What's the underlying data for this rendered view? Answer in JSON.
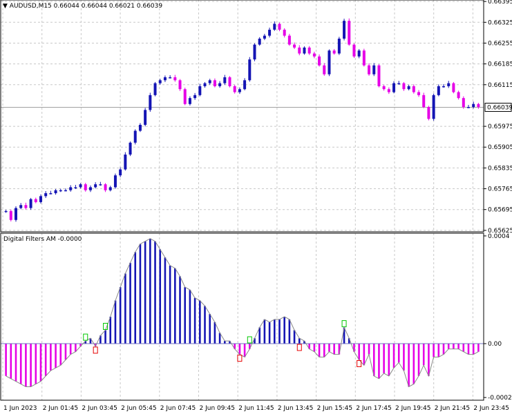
{
  "main_header": {
    "collapse_arrow": "▼",
    "symbol": "AUDUSD,M15",
    "ohlc": "0.66044 0.66044 0.66021 0.66039"
  },
  "indicator_header": {
    "text": "Digital Filters AM -0.0000"
  },
  "price_marker": "0.66039",
  "colors": {
    "bull": "#1414b4",
    "bear": "#e600e6",
    "grid": "#c8c8c8",
    "line": "#888888",
    "signal_up": "#00c800",
    "signal_down": "#e60000"
  },
  "chart_data": [
    {
      "type": "candlestick",
      "title": "AUDUSD,M15",
      "y_ticks": [
        0.66395,
        0.66325,
        0.66255,
        0.66185,
        0.66115,
        0.66039,
        0.65975,
        0.65905,
        0.65835,
        0.65765,
        0.65695,
        0.65625
      ],
      "y_tick_labels": [
        "0.66395",
        "0.66325",
        "0.66255",
        "0.66185",
        "0.66115",
        "0.66039",
        "0.65975",
        "0.65905",
        "0.65835",
        "0.65765",
        "0.65695",
        "0.65625"
      ],
      "last_price": 0.66039,
      "ylim": [
        0.6562,
        0.664
      ],
      "closes": [
        0.6569,
        0.6566,
        0.657,
        0.6571,
        0.657,
        0.6573,
        0.6572,
        0.6574,
        0.6575,
        0.6575,
        0.6576,
        0.6576,
        0.6576,
        0.6577,
        0.6577,
        0.6578,
        0.6576,
        0.6577,
        0.6578,
        0.6578,
        0.6576,
        0.6577,
        0.6581,
        0.6583,
        0.6588,
        0.6592,
        0.6596,
        0.6598,
        0.6603,
        0.6608,
        0.6612,
        0.6613,
        0.6614,
        0.6614,
        0.6613,
        0.661,
        0.6605,
        0.6607,
        0.6608,
        0.6611,
        0.6612,
        0.6613,
        0.6611,
        0.6612,
        0.6614,
        0.6611,
        0.6609,
        0.661,
        0.6613,
        0.662,
        0.6625,
        0.6627,
        0.6628,
        0.663,
        0.6632,
        0.663,
        0.6628,
        0.6625,
        0.6624,
        0.6622,
        0.6624,
        0.6622,
        0.6621,
        0.6618,
        0.6615,
        0.6623,
        0.6622,
        0.6627,
        0.6633,
        0.6625,
        0.6621,
        0.6623,
        0.6618,
        0.6615,
        0.6618,
        0.6611,
        0.661,
        0.6609,
        0.6612,
        0.6612,
        0.661,
        0.6611,
        0.6609,
        0.6608,
        0.6604,
        0.66,
        0.6608,
        0.6611,
        0.6611,
        0.6612,
        0.6609,
        0.6607,
        0.6604,
        0.6604,
        0.6605,
        0.6604
      ]
    },
    {
      "type": "histogram",
      "title": "Digital Filters AM -0.0000",
      "y_ticks": [
        0.0004,
        0.0,
        -0.0002
      ],
      "y_tick_labels": [
        "0.0004",
        "0.00",
        "-0.0002"
      ],
      "ylim": [
        -0.00021,
        0.00041
      ],
      "values": [
        -0.00012,
        -0.00013,
        -0.00014,
        -0.00015,
        -0.00016,
        -0.00016,
        -0.00015,
        -0.00014,
        -0.00012,
        -0.0001,
        -9e-05,
        -8e-05,
        -6e-05,
        -4e-05,
        -3e-05,
        -1e-05,
        1e-05,
        2e-05,
        -1e-05,
        3e-05,
        5e-05,
        0.0001,
        0.00016,
        0.00021,
        0.00026,
        0.0003,
        0.00034,
        0.00037,
        0.00038,
        0.00039,
        0.00038,
        0.00035,
        0.00032,
        0.00029,
        0.00028,
        0.00025,
        0.00021,
        0.0002,
        0.00017,
        0.00016,
        0.00014,
        0.00011,
        8e-05,
        4e-05,
        1e-05,
        1e-05,
        -2e-05,
        -4e-05,
        -5e-05,
        -2e-05,
        2e-05,
        6e-05,
        9e-05,
        8e-05,
        9e-05,
        9e-05,
        0.0001,
        9e-05,
        5e-05,
        2e-05,
        1e-05,
        -2e-05,
        -3e-05,
        -5e-05,
        -5e-05,
        -3e-05,
        -4e-05,
        -4e-05,
        6e-05,
        2e-05,
        -3e-05,
        -6e-05,
        -8e-05,
        -4e-05,
        -0.00012,
        -0.00013,
        -0.00011,
        -0.00012,
        -9e-05,
        -7e-05,
        -0.0001,
        -0.00016,
        -0.00015,
        -0.00012,
        -8e-05,
        -0.00012,
        -5e-05,
        -5e-05,
        -4e-05,
        -2e-05,
        -2e-05,
        -2e-05,
        -3e-05,
        -4e-05,
        -4e-05,
        -3e-05
      ],
      "signals_up": [
        16,
        20,
        49,
        68
      ],
      "signals_down": [
        18,
        47,
        59,
        71
      ]
    }
  ],
  "x_labels": [
    "1 Jun 2023",
    "2 Jun 01:45",
    "2 Jun 03:45",
    "2 Jun 05:45",
    "2 Jun 07:45",
    "2 Jun 09:45",
    "2 Jun 11:45",
    "2 Jun 13:45",
    "2 Jun 15:45",
    "2 Jun 17:45",
    "2 Jun 19:45",
    "2 Jun 21:45",
    "2 Jun 23:45"
  ]
}
